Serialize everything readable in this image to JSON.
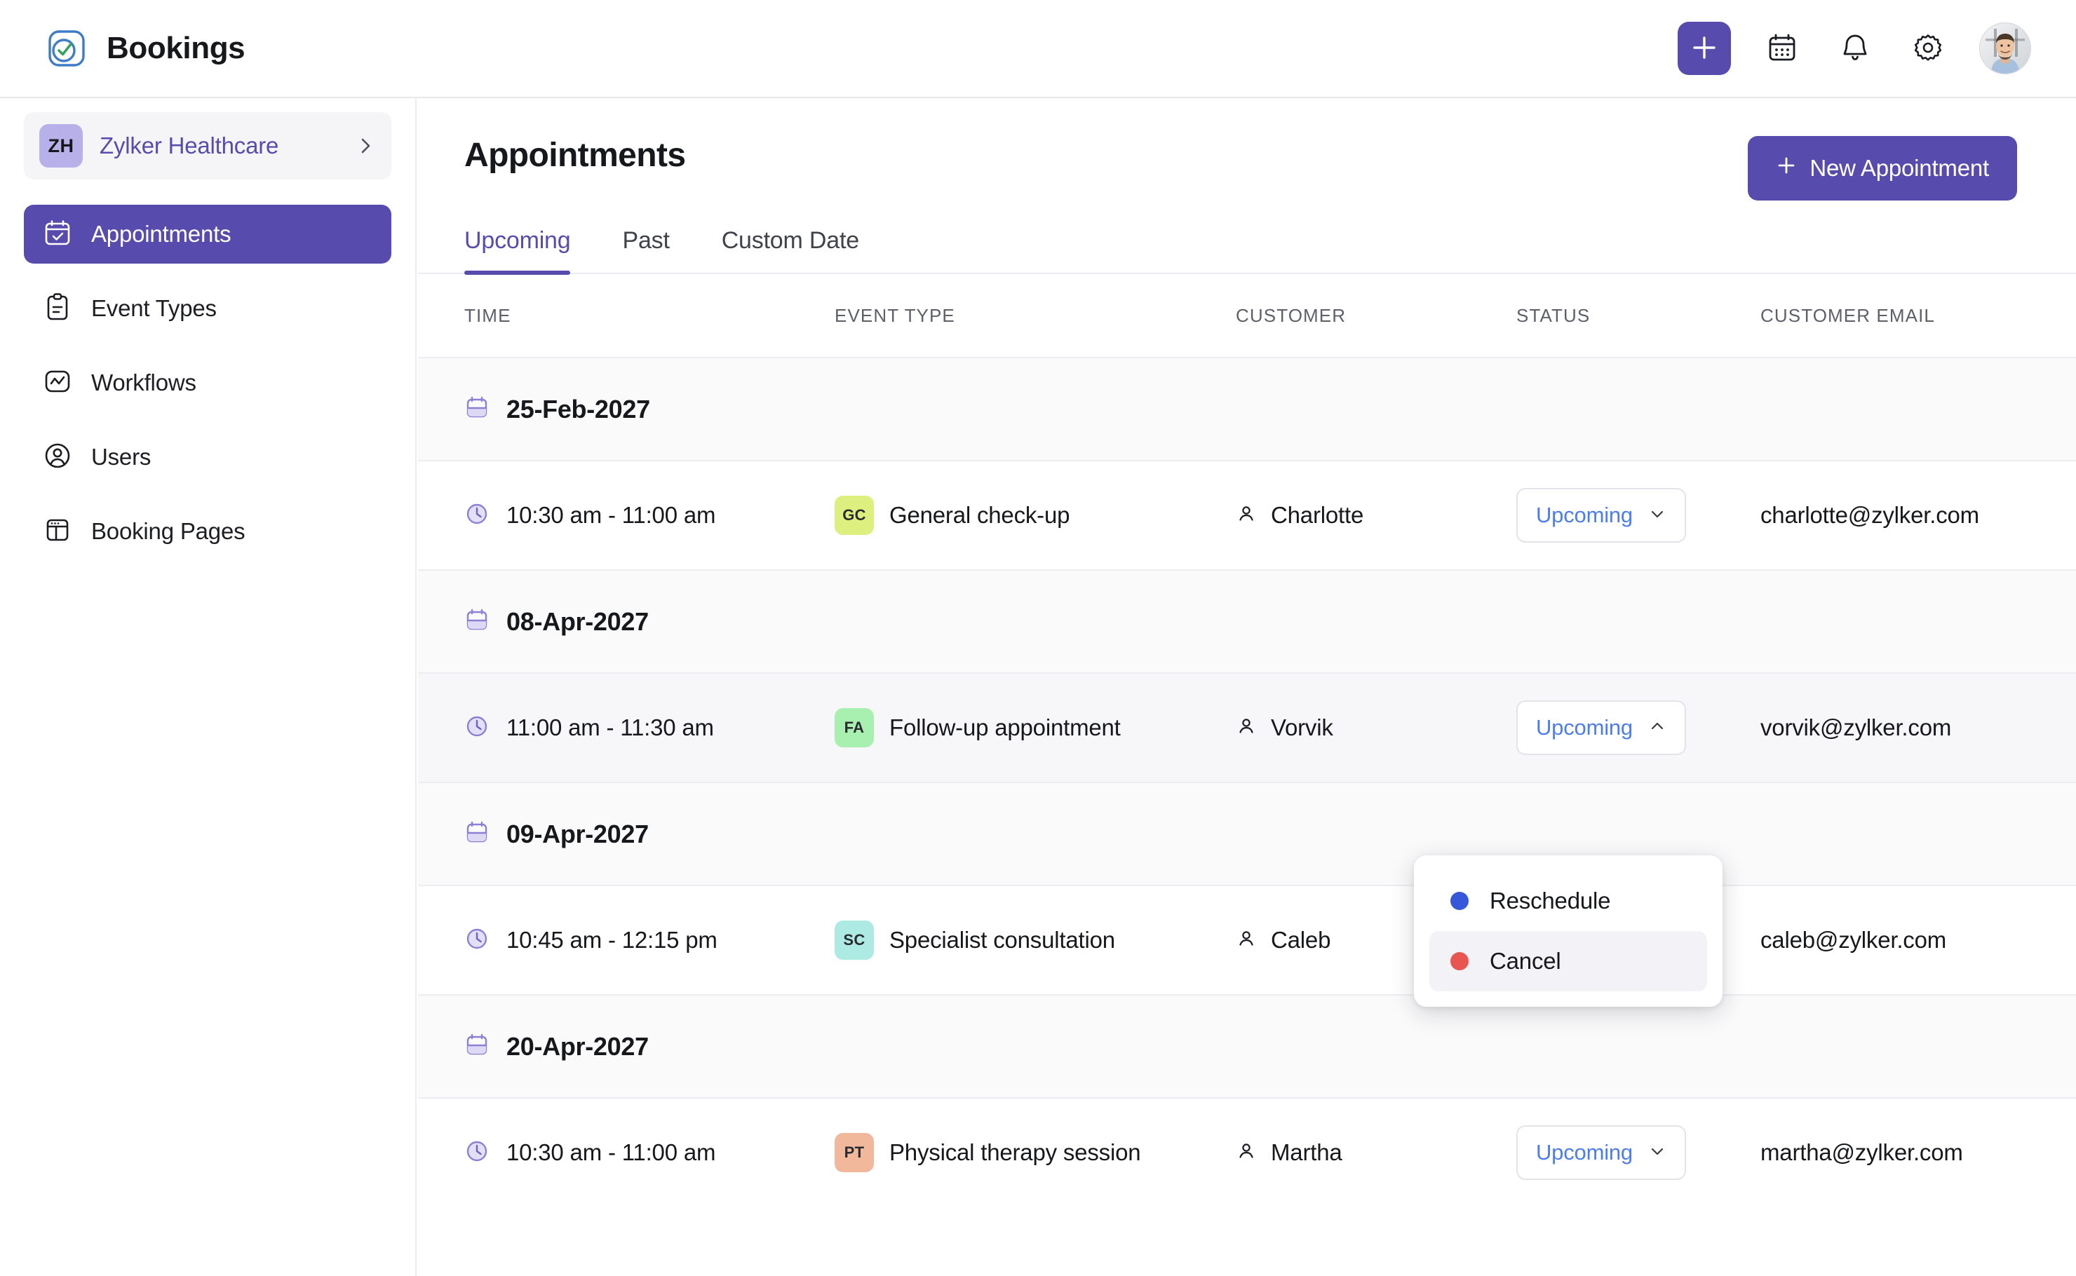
{
  "app": {
    "name": "Bookings",
    "logo_icon": "bookings-logo-icon"
  },
  "topbar": {
    "add_icon": "plus-icon",
    "calendar_icon": "calendar-icon",
    "notifications_icon": "bell-icon",
    "settings_icon": "gear-icon",
    "avatar_icon": "user-avatar"
  },
  "sidebar": {
    "org": {
      "initials": "ZH",
      "name": "Zylker Healthcare",
      "chevron_icon": "chevron-right-icon"
    },
    "items": [
      {
        "label": "Appointments",
        "icon": "calendar-check-icon",
        "active": true
      },
      {
        "label": "Event Types",
        "icon": "clipboard-list-icon",
        "active": false
      },
      {
        "label": "Workflows",
        "icon": "workflow-zigzag-icon",
        "active": false
      },
      {
        "label": "Users",
        "icon": "user-circle-icon",
        "active": false
      },
      {
        "label": "Booking Pages",
        "icon": "layout-pages-icon",
        "active": false
      }
    ]
  },
  "main": {
    "title": "Appointments",
    "new_appointment_label": "New Appointment",
    "new_appointment_icon": "plus-icon",
    "tabs": [
      {
        "label": "Upcoming",
        "active": true
      },
      {
        "label": "Past",
        "active": false
      },
      {
        "label": "Custom Date",
        "active": false
      }
    ],
    "columns": [
      "TIME",
      "EVENT TYPE",
      "CUSTOMER",
      "STATUS",
      "CUSTOMER EMAIL"
    ],
    "groups": [
      {
        "date": "25-Feb-2027",
        "date_icon": "calendar-icon",
        "rows": [
          {
            "time": "10:30 am - 11:00 am",
            "time_icon": "clock-icon",
            "event_initials": "GC",
            "event_badge_color": "#ddf07f",
            "event_type": "General check-up",
            "customer": "Charlotte",
            "customer_icon": "person-icon",
            "status": "Upcoming",
            "status_chevron": "chevron-down-icon",
            "email": "charlotte@zylker.com",
            "highlight": false
          }
        ]
      },
      {
        "date": "08-Apr-2027",
        "date_icon": "calendar-icon",
        "rows": [
          {
            "time": "11:00 am - 11:30 am",
            "time_icon": "clock-icon",
            "event_initials": "FA",
            "event_badge_color": "#a8f0b0",
            "event_type": "Follow-up appointment",
            "customer": "Vorvik",
            "customer_icon": "person-icon",
            "status": "Upcoming",
            "status_chevron": "chevron-up-icon",
            "email": "vorvik@zylker.com",
            "highlight": true
          }
        ]
      },
      {
        "date": "09-Apr-2027",
        "date_icon": "calendar-icon",
        "rows": [
          {
            "time": "10:45 am - 12:15 pm",
            "time_icon": "clock-icon",
            "event_initials": "SC",
            "event_badge_color": "#aeeae4",
            "event_type": "Specialist consultation",
            "customer": "Caleb",
            "customer_icon": "person-icon",
            "status": "Upcoming",
            "status_chevron": "chevron-down-icon",
            "email": "caleb@zylker.com",
            "highlight": false
          }
        ]
      },
      {
        "date": "20-Apr-2027",
        "date_icon": "calendar-icon",
        "rows": [
          {
            "time": "10:30 am - 11:00 am",
            "time_icon": "clock-icon",
            "event_initials": "PT",
            "event_badge_color": "#f2b89b",
            "event_type": "Physical therapy session",
            "customer": "Martha",
            "customer_icon": "person-icon",
            "status": "Upcoming",
            "status_chevron": "chevron-down-icon",
            "email": "martha@zylker.com",
            "highlight": false
          }
        ]
      }
    ]
  },
  "status_menu": {
    "open": true,
    "items": [
      {
        "label": "Reschedule",
        "dot_color": "#3657d9",
        "hovered": false
      },
      {
        "label": "Cancel",
        "dot_color": "#e8564f",
        "hovered": true
      }
    ]
  },
  "colors": {
    "accent": "#584bae",
    "status_text": "#4c7df0",
    "row_highlight": "#f7f7fa",
    "date_row_bg": "#fafafb"
  }
}
